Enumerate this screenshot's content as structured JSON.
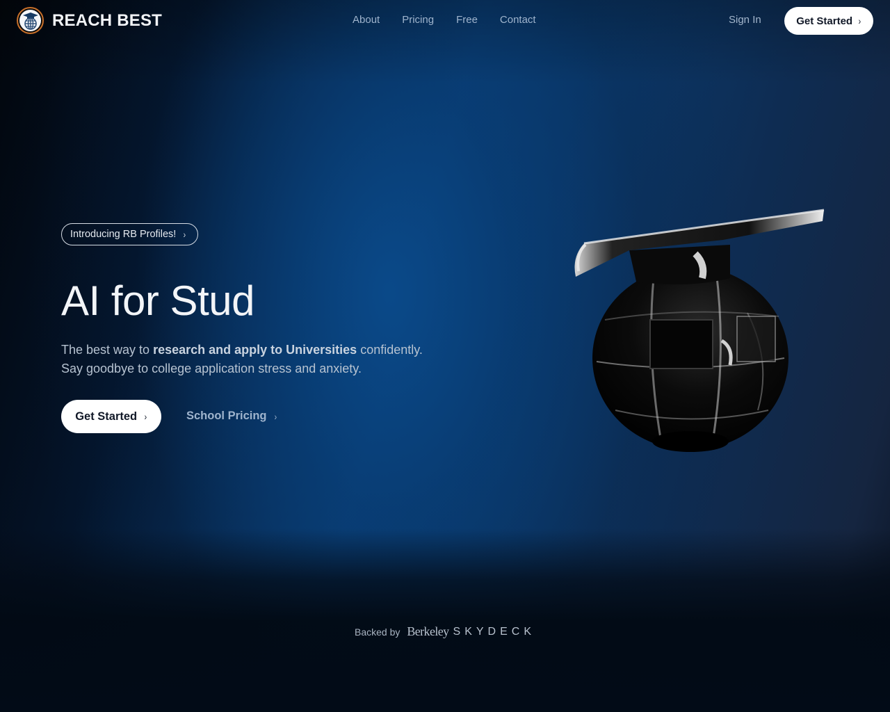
{
  "header": {
    "brand_name": "REACH BEST",
    "logo_icon": "graduation-cap-globe-icon",
    "nav": [
      {
        "label": "About"
      },
      {
        "label": "Pricing"
      },
      {
        "label": "Free"
      },
      {
        "label": "Contact"
      }
    ],
    "sign_in_label": "Sign In",
    "get_started_label": "Get Started",
    "chevron": "›"
  },
  "hero": {
    "announcement": "Introducing RB Profiles!",
    "headline": "AI for Stud",
    "subtitle": {
      "part1": "The best way to ",
      "bold": "research and apply to Universities",
      "part2": " confidently.",
      "line2": "Say goodbye to college application stress and anxiety."
    },
    "primary_cta": "Get Started",
    "secondary_cta": "School Pricing",
    "chevron": "›",
    "illustration": "graduation-cap-globe-3d"
  },
  "footer": {
    "backed_by_label": "Backed by",
    "sponsor_part1": "Berkeley",
    "sponsor_part2": "SKYDECK"
  },
  "colors": {
    "accent_blue": "#0a4a8a",
    "logo_ring": "#c8702a",
    "nav_text": "#9fb4cd"
  }
}
